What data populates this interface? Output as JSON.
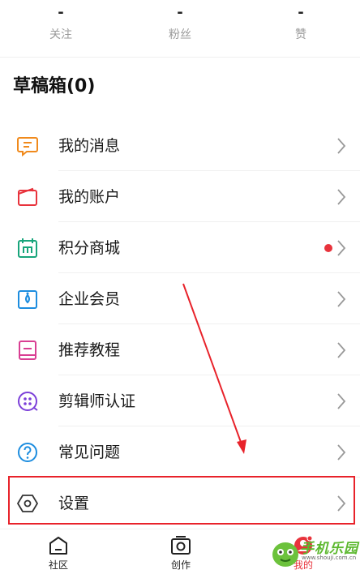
{
  "stats": [
    {
      "value": "-",
      "label": "关注"
    },
    {
      "value": "-",
      "label": "粉丝"
    },
    {
      "value": "-",
      "label": "赞"
    }
  ],
  "drafts_title": "草稿箱(0)",
  "menu": [
    {
      "label": "我的消息",
      "icon": "message-icon",
      "color": "#f08a1c"
    },
    {
      "label": "我的账户",
      "icon": "wallet-icon",
      "color": "#e8333c"
    },
    {
      "label": "积分商城",
      "icon": "shop-icon",
      "color": "#18a57b",
      "badge": true
    },
    {
      "label": "企业会员",
      "icon": "enterprise-icon",
      "color": "#1d8ddf"
    },
    {
      "label": "推荐教程",
      "icon": "book-icon",
      "color": "#d93f93"
    },
    {
      "label": "剪辑师认证",
      "icon": "editor-badge-icon",
      "color": "#7b3fd9"
    },
    {
      "label": "常见问题",
      "icon": "question-icon",
      "color": "#1d8ddf"
    },
    {
      "label": "设置",
      "icon": "settings-hexagon-icon",
      "color": "#333333"
    }
  ],
  "tabs": [
    {
      "label": "社区",
      "icon": "home-icon"
    },
    {
      "label": "创作",
      "icon": "camera-icon"
    },
    {
      "label": "我的",
      "icon": "profile-icon"
    }
  ],
  "watermark": {
    "text": "手机乐园",
    "url": "www.shouji.com.cn"
  },
  "colors": {
    "highlight": "#e8222a",
    "badge": "#e8333c",
    "watermark": "#5cb82e"
  }
}
